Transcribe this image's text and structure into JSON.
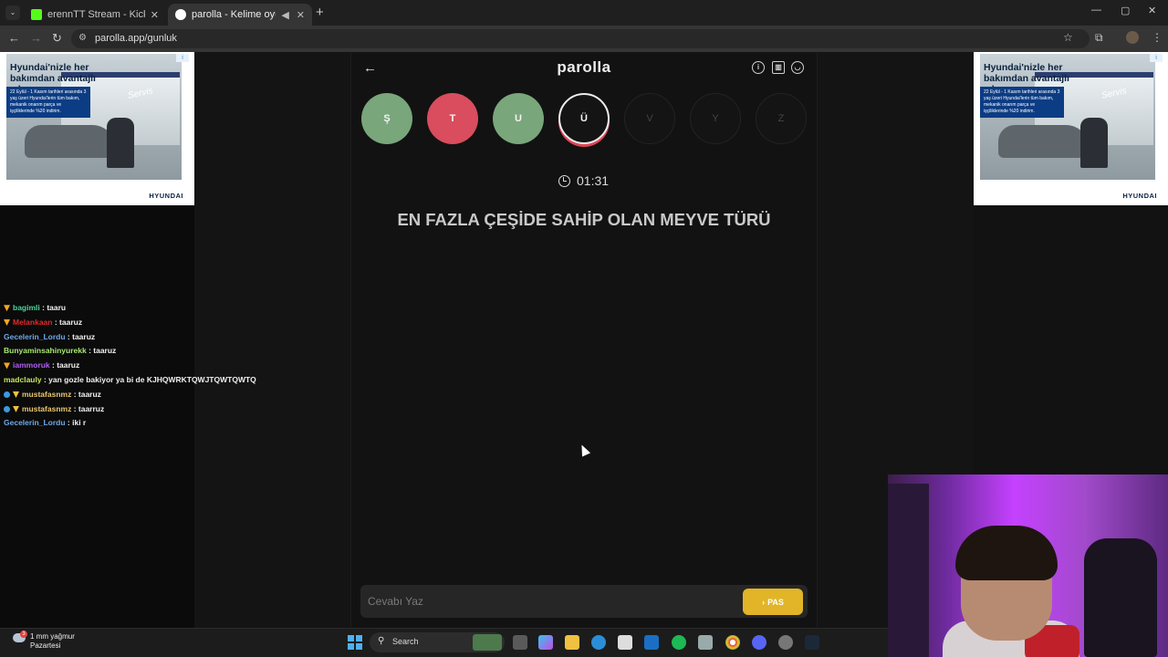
{
  "browser": {
    "tabs": [
      {
        "title": "erennTT Stream - Kick Dashboar",
        "favicon_color": "#53fc18"
      },
      {
        "title": "parolla - Kelime oyunu. Gün",
        "favicon_color": "#ffffff"
      }
    ],
    "url": "parolla.app/gunluk",
    "new_tab": "+",
    "controls": {
      "minimize": "—",
      "maximize": "▢",
      "close": "✕"
    }
  },
  "ads": {
    "headline": "Hyundai'nizle her bakımdan avantajlı çıkın.",
    "promo": "22 Eylül - 1 Kasım tarihleri arasında 3 yaş üzeri Hyundai'lerin tüm bakım, mekanik onarım parça ve işçiliklerinde %20 indirim.",
    "servis": "Servis",
    "brand": "HYUNDAI",
    "adchoice": "i"
  },
  "game": {
    "logo": "parolla",
    "letters": [
      {
        "char": "Ş",
        "state": "correct"
      },
      {
        "char": "T",
        "state": "wrong"
      },
      {
        "char": "U",
        "state": "correct"
      },
      {
        "char": "Ü",
        "state": "current"
      },
      {
        "char": "V",
        "state": "pending"
      },
      {
        "char": "Y",
        "state": "pending"
      },
      {
        "char": "Z",
        "state": "pending"
      }
    ],
    "timer": "01:31",
    "question": "EN FAZLA ÇEŞİDE SAHİP OLAN MEYVE TÜRÜ",
    "answer_placeholder": "Cevabı Yaz",
    "pass_button": "PAS",
    "colors": {
      "correct": "#79a67b",
      "wrong": "#d94d5e",
      "pass": "#e1b527"
    }
  },
  "chat": [
    {
      "user": "bagimli",
      "color": "#4fd39a",
      "message": "taaru",
      "badge": "b1"
    },
    {
      "user": "Melankaan",
      "color": "#e02b2b",
      "message": "taaruz",
      "badge": "b1"
    },
    {
      "user": "Gecelerin_Lordu",
      "color": "#6ea8e8",
      "message": "taaruz",
      "badge": ""
    },
    {
      "user": "Bunyaminsahinyurekk",
      "color": "#a6e86e",
      "message": "taaruz",
      "badge": ""
    },
    {
      "user": "iammoruk",
      "color": "#b15ef0",
      "message": "taaruz",
      "badge": "b1"
    },
    {
      "user": "madclauly",
      "color": "#c7e85e",
      "message": "yan gozle bakiyor ya bi de KJHQWRKTQWJTQWTQWTQ",
      "badge": ""
    },
    {
      "user": "mustafasnmz",
      "color": "#e8c66e",
      "message": "taaruz",
      "badge": "b2b3"
    },
    {
      "user": "mustafasnmz",
      "color": "#e8c66e",
      "message": "taarruz",
      "badge": "b2b3"
    },
    {
      "user": "Gecelerin_Lordu",
      "color": "#6ea8e8",
      "message": "iki r",
      "badge": ""
    }
  ],
  "taskbar": {
    "weather_badge": "3",
    "weather_line1": "1 mm yağmur",
    "weather_line2": "Pazartesi",
    "search": "Search"
  }
}
